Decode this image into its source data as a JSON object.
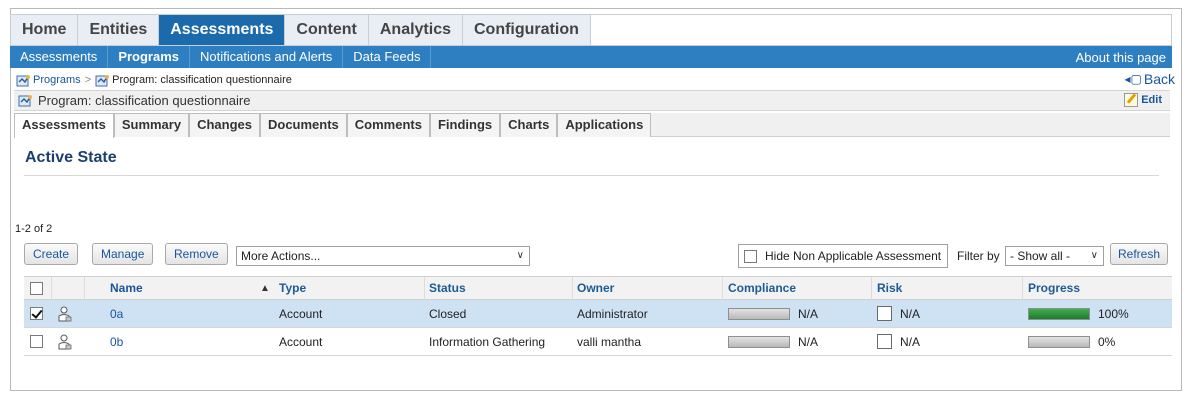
{
  "topnav": {
    "tabs": [
      {
        "label": "Home"
      },
      {
        "label": "Entities"
      },
      {
        "label": "Assessments",
        "active": true
      },
      {
        "label": "Content"
      },
      {
        "label": "Analytics"
      },
      {
        "label": "Configuration"
      }
    ]
  },
  "subnav": {
    "items": [
      {
        "label": "Assessments"
      },
      {
        "label": "Programs",
        "active": true
      },
      {
        "label": "Notifications and Alerts"
      },
      {
        "label": "Data Feeds"
      }
    ],
    "about": "About this page"
  },
  "breadcrumb": {
    "root": "Programs",
    "separator": ">",
    "current": "Program: classification questionnaire",
    "back": "Back"
  },
  "page": {
    "title": "Program: classification questionnaire",
    "edit": "Edit"
  },
  "subtabs": [
    {
      "label": "Assessments",
      "active": true
    },
    {
      "label": "Summary"
    },
    {
      "label": "Changes"
    },
    {
      "label": "Documents"
    },
    {
      "label": "Comments"
    },
    {
      "label": "Findings"
    },
    {
      "label": "Charts"
    },
    {
      "label": "Applications"
    }
  ],
  "section": {
    "title": "Active State",
    "count": "1-2 of 2"
  },
  "toolbar": {
    "create": "Create",
    "manage": "Manage",
    "remove": "Remove",
    "more_actions": "More Actions...",
    "hide_non_applicable": "Hide Non Applicable Assessment",
    "filter_label": "Filter by",
    "filter_value": "- Show all -",
    "refresh": "Refresh"
  },
  "table": {
    "columns": [
      "Name",
      "Type",
      "Status",
      "Owner",
      "Compliance",
      "Risk",
      "Progress"
    ],
    "rows": [
      {
        "checked": true,
        "name": "0a",
        "type": "Account",
        "status": "Closed",
        "owner": "Administrator",
        "compliance": "N/A",
        "risk": "N/A",
        "progress_label": "100%",
        "progress_fraction": 1.0
      },
      {
        "checked": false,
        "name": "0b",
        "type": "Account",
        "status": "Information Gathering",
        "owner": "valli mantha",
        "compliance": "N/A",
        "risk": "N/A",
        "progress_label": "0%",
        "progress_fraction": 0.0
      }
    ]
  },
  "icons": {
    "program": "program-icon",
    "owner": "user-icon",
    "back": "back-icon",
    "edit": "edit-icon"
  },
  "colors": {
    "nav_active": "#1b6aab",
    "subnav": "#2d7fc1",
    "selected_row": "#cfe2f4",
    "progress_fill": "#2e8b3c"
  }
}
